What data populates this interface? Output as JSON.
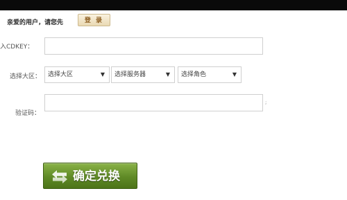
{
  "header": {
    "greeting": "亲爱的用户，请您先",
    "login_label": "登 录"
  },
  "form": {
    "cdkey_label": "入CDKEY：",
    "cdkey_value": "",
    "region_label": "选择大区：",
    "region_select": "选择大区",
    "server_select": "选择服务器",
    "role_select": "选择角色",
    "captcha_label": "验证码：",
    "captcha_value": "",
    "captcha_marker": ";",
    "dropdown_arrow": "▼"
  },
  "confirm": {
    "label": "确定兑换",
    "icon": "swap-arrows-icon"
  },
  "colors": {
    "topbar": "#0a0a0a",
    "login_text": "#8a5a1c",
    "confirm_bg": "#5f8a26"
  }
}
